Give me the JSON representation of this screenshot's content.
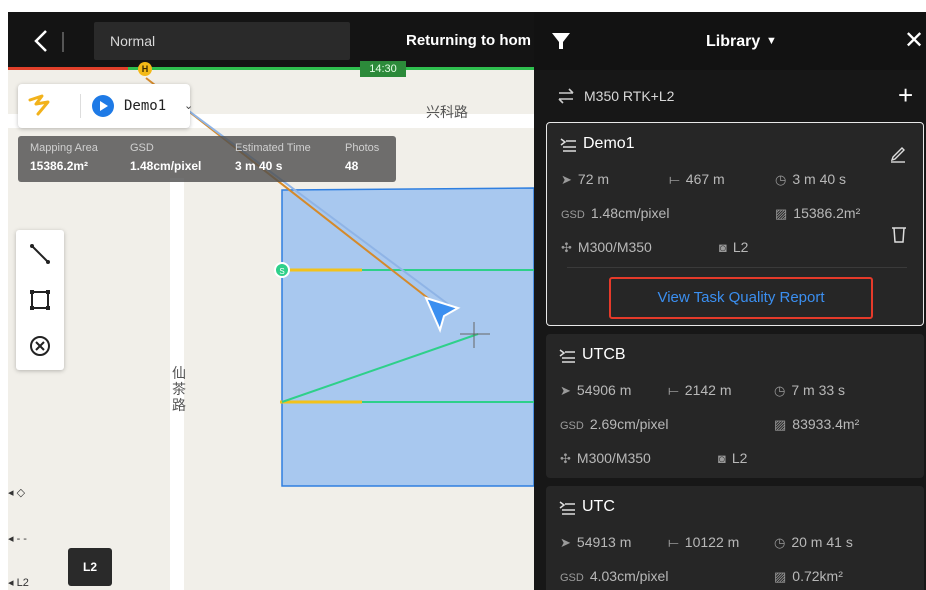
{
  "topbar": {
    "mode": "Normal",
    "status": "Returning to hom",
    "time_badge": "14:30",
    "home_marker": "H"
  },
  "map": {
    "road_horizontal": "兴科路",
    "road_vertical": "仙茶路",
    "start_marker": "S"
  },
  "route_chip": {
    "name": "Demo1"
  },
  "stats": [
    {
      "label": "Mapping Area",
      "value": "15386.2m²"
    },
    {
      "label": "GSD",
      "value": "1.48cm/pixel"
    },
    {
      "label": "Estimated Time",
      "value": "3 m 40 s"
    },
    {
      "label": "Photos",
      "value": "48"
    }
  ],
  "tools": [
    "line-tool-icon",
    "area-tool-icon",
    "cancel-tool-icon"
  ],
  "bottom_left": {
    "l2_small": "L2",
    "l2_badge": "L2"
  },
  "library": {
    "title": "Library",
    "model": "M350 RTK+L2",
    "cards": [
      {
        "name": "Demo1",
        "altitude": "72 m",
        "length": "467 m",
        "time": "3 m 40 s",
        "gsd_tag": "GSD",
        "gsd": "1.48cm/pixel",
        "area": "15386.2m²",
        "drone": "M300/M350",
        "payload": "L2",
        "report_label": "View Task Quality Report"
      },
      {
        "name": "UTCB",
        "altitude": "54906 m",
        "length": "2142 m",
        "time": "7 m 33 s",
        "gsd_tag": "GSD",
        "gsd": "2.69cm/pixel",
        "area": "83933.4m²",
        "drone": "M300/M350",
        "payload": "L2"
      },
      {
        "name": "UTC",
        "altitude": "54913 m",
        "length": "10122 m",
        "time": "20 m 41 s",
        "gsd_tag": "GSD",
        "gsd": "4.03cm/pixel",
        "area": "0.72km²"
      }
    ]
  },
  "colors": {
    "accent_blue": "#3b8ff0",
    "highlight_red": "#e53a2a",
    "mapping_area_fill": "#a8c8ef",
    "route_green": "#2ed08a",
    "route_yellow": "#f2c21b"
  }
}
